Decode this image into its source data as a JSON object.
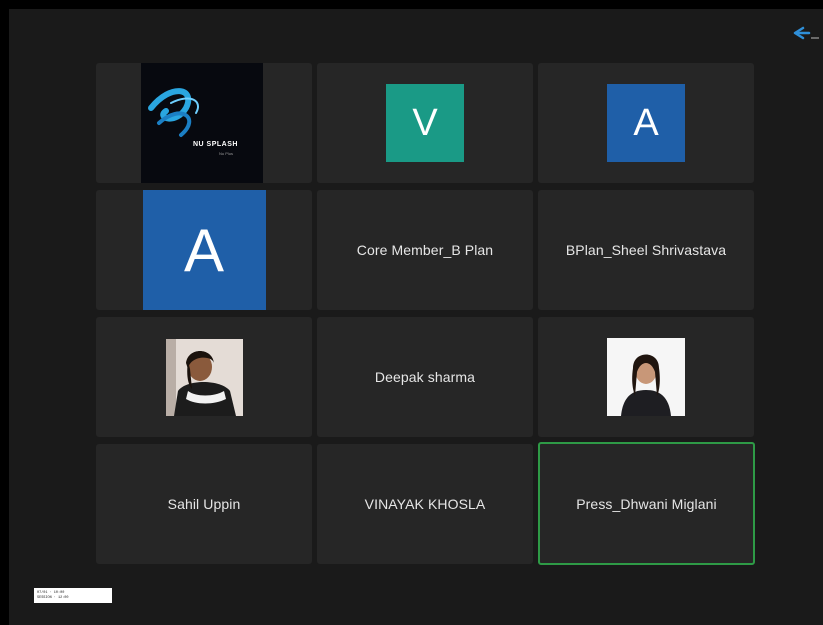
{
  "participants": [
    {
      "name": "",
      "type": "logo",
      "logo_text": "NU SPLASH",
      "logo_sub": "Nu Plus"
    },
    {
      "name": "",
      "type": "initial",
      "initial": "V",
      "color": "#1a9a86"
    },
    {
      "name": "",
      "type": "initial",
      "initial": "A",
      "color": "#1f5fa8"
    },
    {
      "name": "",
      "type": "initial-large",
      "initial": "A",
      "color": "#1f5fa8"
    },
    {
      "name": "Core Member_B Plan",
      "type": "name"
    },
    {
      "name": "BPlan_Sheel Shrivastava",
      "type": "name"
    },
    {
      "name": "",
      "type": "photo"
    },
    {
      "name": "Deepak sharma",
      "type": "name"
    },
    {
      "name": "",
      "type": "photo"
    },
    {
      "name": "Sahil Uppin",
      "type": "name"
    },
    {
      "name": "VINAYAK KHOSLA",
      "type": "name"
    },
    {
      "name": "Press_Dhwani Miglani",
      "type": "name",
      "active": true
    }
  ],
  "stamp": {
    "line1": "07/01 · 10:00",
    "line2": "SESSION · 12:00"
  },
  "active_speaker_color": "#2e9a46",
  "corner_icon": "zoom-return-icon"
}
